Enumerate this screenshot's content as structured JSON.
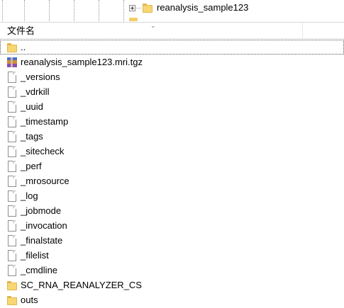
{
  "tree": {
    "node_label": "reanalysis_sample123"
  },
  "header": {
    "name_column": "文件名"
  },
  "files": [
    {
      "name": "..",
      "icon": "folder-icon",
      "focused": true
    },
    {
      "name": "reanalysis_sample123.mri.tgz",
      "icon": "archive-icon"
    },
    {
      "name": "_versions",
      "icon": "file-icon"
    },
    {
      "name": "_vdrkill",
      "icon": "file-icon"
    },
    {
      "name": "_uuid",
      "icon": "file-icon"
    },
    {
      "name": "_timestamp",
      "icon": "file-icon"
    },
    {
      "name": "_tags",
      "icon": "file-icon"
    },
    {
      "name": "_sitecheck",
      "icon": "file-icon"
    },
    {
      "name": "_perf",
      "icon": "file-icon"
    },
    {
      "name": "_mrosource",
      "icon": "file-icon"
    },
    {
      "name": "_log",
      "icon": "file-icon"
    },
    {
      "name": "_jobmode",
      "icon": "file-icon"
    },
    {
      "name": "_invocation",
      "icon": "file-icon"
    },
    {
      "name": "_finalstate",
      "icon": "file-icon"
    },
    {
      "name": "_filelist",
      "icon": "file-icon"
    },
    {
      "name": "_cmdline",
      "icon": "file-icon"
    },
    {
      "name": "SC_RNA_REANALYZER_CS",
      "icon": "folder-icon"
    },
    {
      "name": "outs",
      "icon": "folder-icon"
    }
  ],
  "colors": {
    "folder": "#f7d774",
    "focus_outline": "#555555"
  }
}
